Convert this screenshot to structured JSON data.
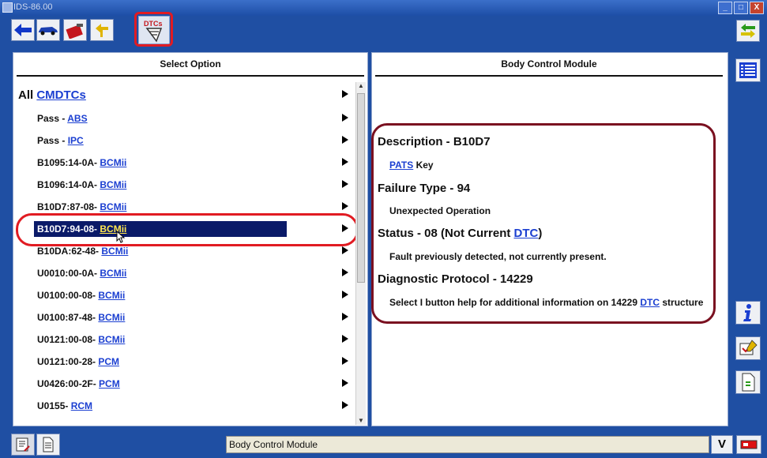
{
  "window": {
    "title": "IDS-86.00",
    "buttons": [
      "_",
      "□",
      "X"
    ]
  },
  "toolbar": {
    "icons": [
      "back-arrow-icon",
      "vehicle-icon",
      "toolbox-icon",
      "connection-icon"
    ],
    "dtc_label": "DTCs"
  },
  "left_panel": {
    "title": "Select Option",
    "all_prefix": "All",
    "all_link": "CMDTCs",
    "items": [
      {
        "prefix": "Pass - ",
        "link": "ABS"
      },
      {
        "prefix": "Pass - ",
        "link": "IPC"
      },
      {
        "prefix": "B1095:14-0A- ",
        "link": "BCMii"
      },
      {
        "prefix": "B1096:14-0A- ",
        "link": "BCMii"
      },
      {
        "prefix": "B10D7:87-08- ",
        "link": "BCMii"
      },
      {
        "prefix": "B10D7:94-08- ",
        "link": "BCMii",
        "selected": true
      },
      {
        "prefix": "B10DA:62-48- ",
        "link": "BCMii"
      },
      {
        "prefix": "U0010:00-0A- ",
        "link": "BCMii"
      },
      {
        "prefix": "U0100:00-08- ",
        "link": "BCMii"
      },
      {
        "prefix": "U0100:87-48- ",
        "link": "BCMii"
      },
      {
        "prefix": "U0121:00-08- ",
        "link": "BCMii"
      },
      {
        "prefix": "U0121:00-28- ",
        "link": "PCM"
      },
      {
        "prefix": "U0426:00-2F- ",
        "link": "PCM"
      },
      {
        "prefix": "U0155- ",
        "link": "RCM"
      }
    ]
  },
  "right_panel": {
    "title": "Body Control Module",
    "description_head": "Description - B10D7",
    "description_link": "PATS",
    "description_rest": " Key",
    "failure_head": "Failure Type - 94",
    "failure_text": "Unexpected Operation",
    "status_head_prefix": "Status - 08 (Not Current ",
    "status_head_link": "DTC",
    "status_head_suffix": ")",
    "status_text": "Fault previously detected, not currently present.",
    "protocol_head": "Diagnostic Protocol - 14229",
    "protocol_text_prefix": "Select I button help for additional information on 14229 ",
    "protocol_text_link": "DTC",
    "protocol_text_suffix": " structure"
  },
  "sidebar": {
    "icons": [
      "swap-arrows-icon",
      "list-icon",
      "info-icon",
      "toolbox-check-icon",
      "document-icon"
    ]
  },
  "status_bar": {
    "text": "Body Control Module",
    "battery_label": "V"
  },
  "colors": {
    "chrome": "#1f4fa3",
    "link": "#1b3fd1",
    "selected_bg": "#0a1a68",
    "highlight": "#e11b22",
    "callout": "#7a1020"
  }
}
